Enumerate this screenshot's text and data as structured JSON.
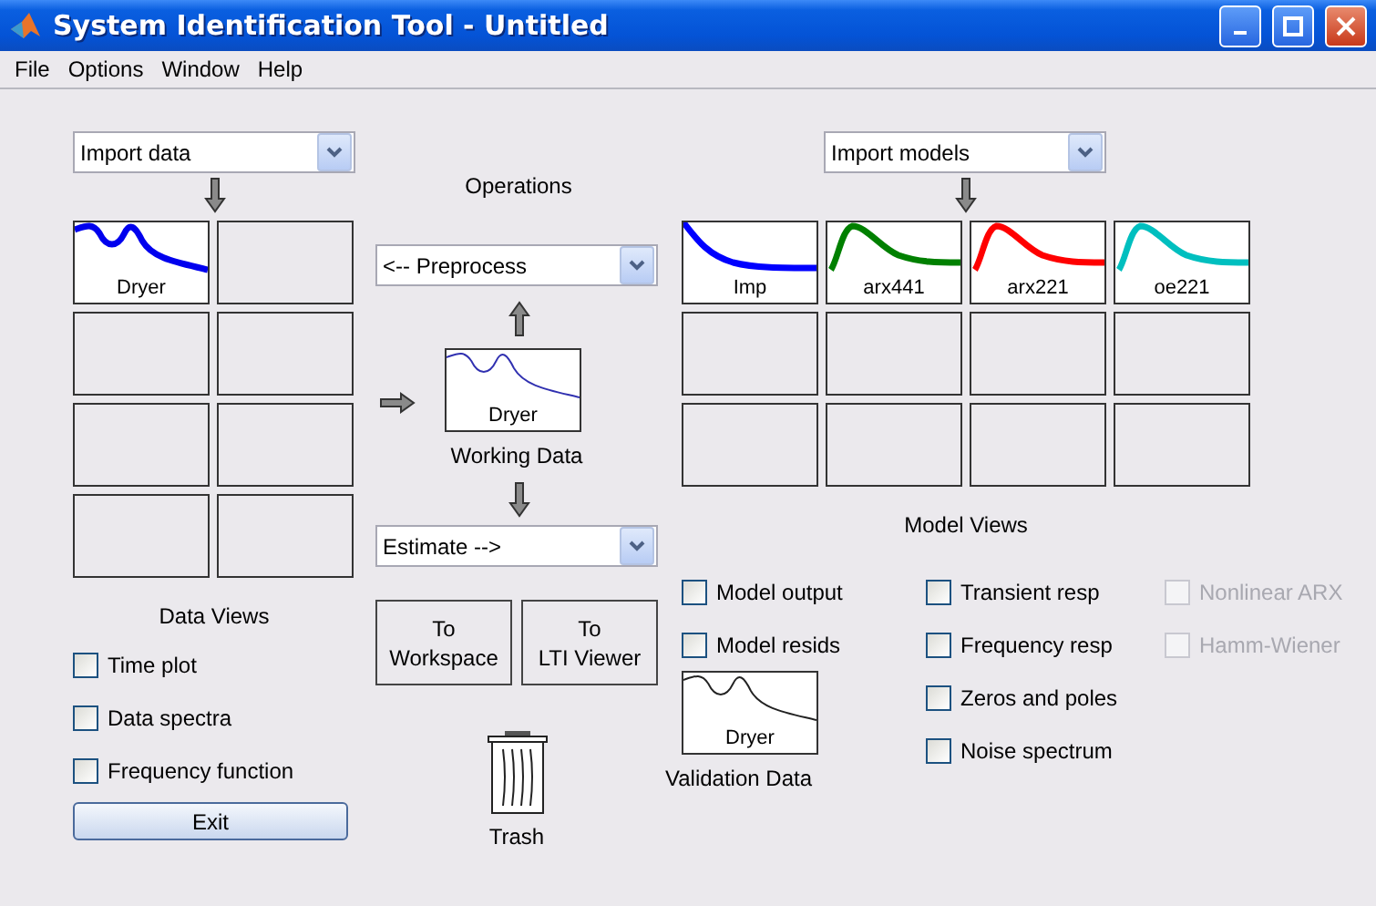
{
  "window": {
    "title": "System Identification Tool - Untitled"
  },
  "menu": [
    "File",
    "Options",
    "Window",
    "Help"
  ],
  "data_panel": {
    "import_dropdown": "Import data",
    "slots": [
      {
        "kind": "plot",
        "label": "Dryer"
      },
      {
        "kind": "empty"
      },
      {
        "kind": "empty"
      },
      {
        "kind": "empty"
      },
      {
        "kind": "empty"
      },
      {
        "kind": "empty"
      },
      {
        "kind": "empty"
      },
      {
        "kind": "empty"
      }
    ],
    "heading": "Data Views",
    "options": [
      {
        "label": "Time plot",
        "checked": false
      },
      {
        "label": "Data spectra",
        "checked": false
      },
      {
        "label": "Frequency function",
        "checked": false
      }
    ],
    "exit_button": "Exit"
  },
  "operations": {
    "heading": "Operations",
    "preprocess_dropdown": "<-- Preprocess",
    "working_data": {
      "label": "Dryer",
      "caption": "Working Data"
    },
    "estimate_dropdown": "Estimate -->",
    "buttons": [
      {
        "line1": "To",
        "line2": "Workspace"
      },
      {
        "line1": "To",
        "line2": "LTI Viewer"
      }
    ],
    "trash": "Trash"
  },
  "model_panel": {
    "import_dropdown": "Import models",
    "slots": [
      {
        "kind": "model",
        "label": "Imp",
        "color": "#0000ff"
      },
      {
        "kind": "model",
        "label": "arx441",
        "color": "#008000"
      },
      {
        "kind": "model",
        "label": "arx221",
        "color": "#ff0000"
      },
      {
        "kind": "model",
        "label": "oe221",
        "color": "#00bfbf"
      },
      {
        "kind": "empty"
      },
      {
        "kind": "empty"
      },
      {
        "kind": "empty"
      },
      {
        "kind": "empty"
      },
      {
        "kind": "empty"
      },
      {
        "kind": "empty"
      },
      {
        "kind": "empty"
      },
      {
        "kind": "empty"
      }
    ],
    "heading": "Model Views",
    "option_groups": [
      {
        "options": [
          {
            "label": "Model output",
            "checked": false,
            "disabled": false
          },
          {
            "label": "Model resids",
            "checked": false,
            "disabled": false
          }
        ]
      },
      {
        "options": [
          {
            "label": "Transient resp",
            "checked": false,
            "disabled": false
          },
          {
            "label": "Frequency resp",
            "checked": false,
            "disabled": false
          },
          {
            "label": "Zeros and poles",
            "checked": false,
            "disabled": false
          },
          {
            "label": "Noise spectrum",
            "checked": false,
            "disabled": false
          }
        ]
      },
      {
        "options": [
          {
            "label": "Nonlinear ARX",
            "checked": false,
            "disabled": true
          },
          {
            "label": "Hamm-Wiener",
            "checked": false,
            "disabled": true
          }
        ]
      }
    ],
    "validation_data": {
      "label": "Dryer",
      "caption": "Validation Data"
    }
  }
}
